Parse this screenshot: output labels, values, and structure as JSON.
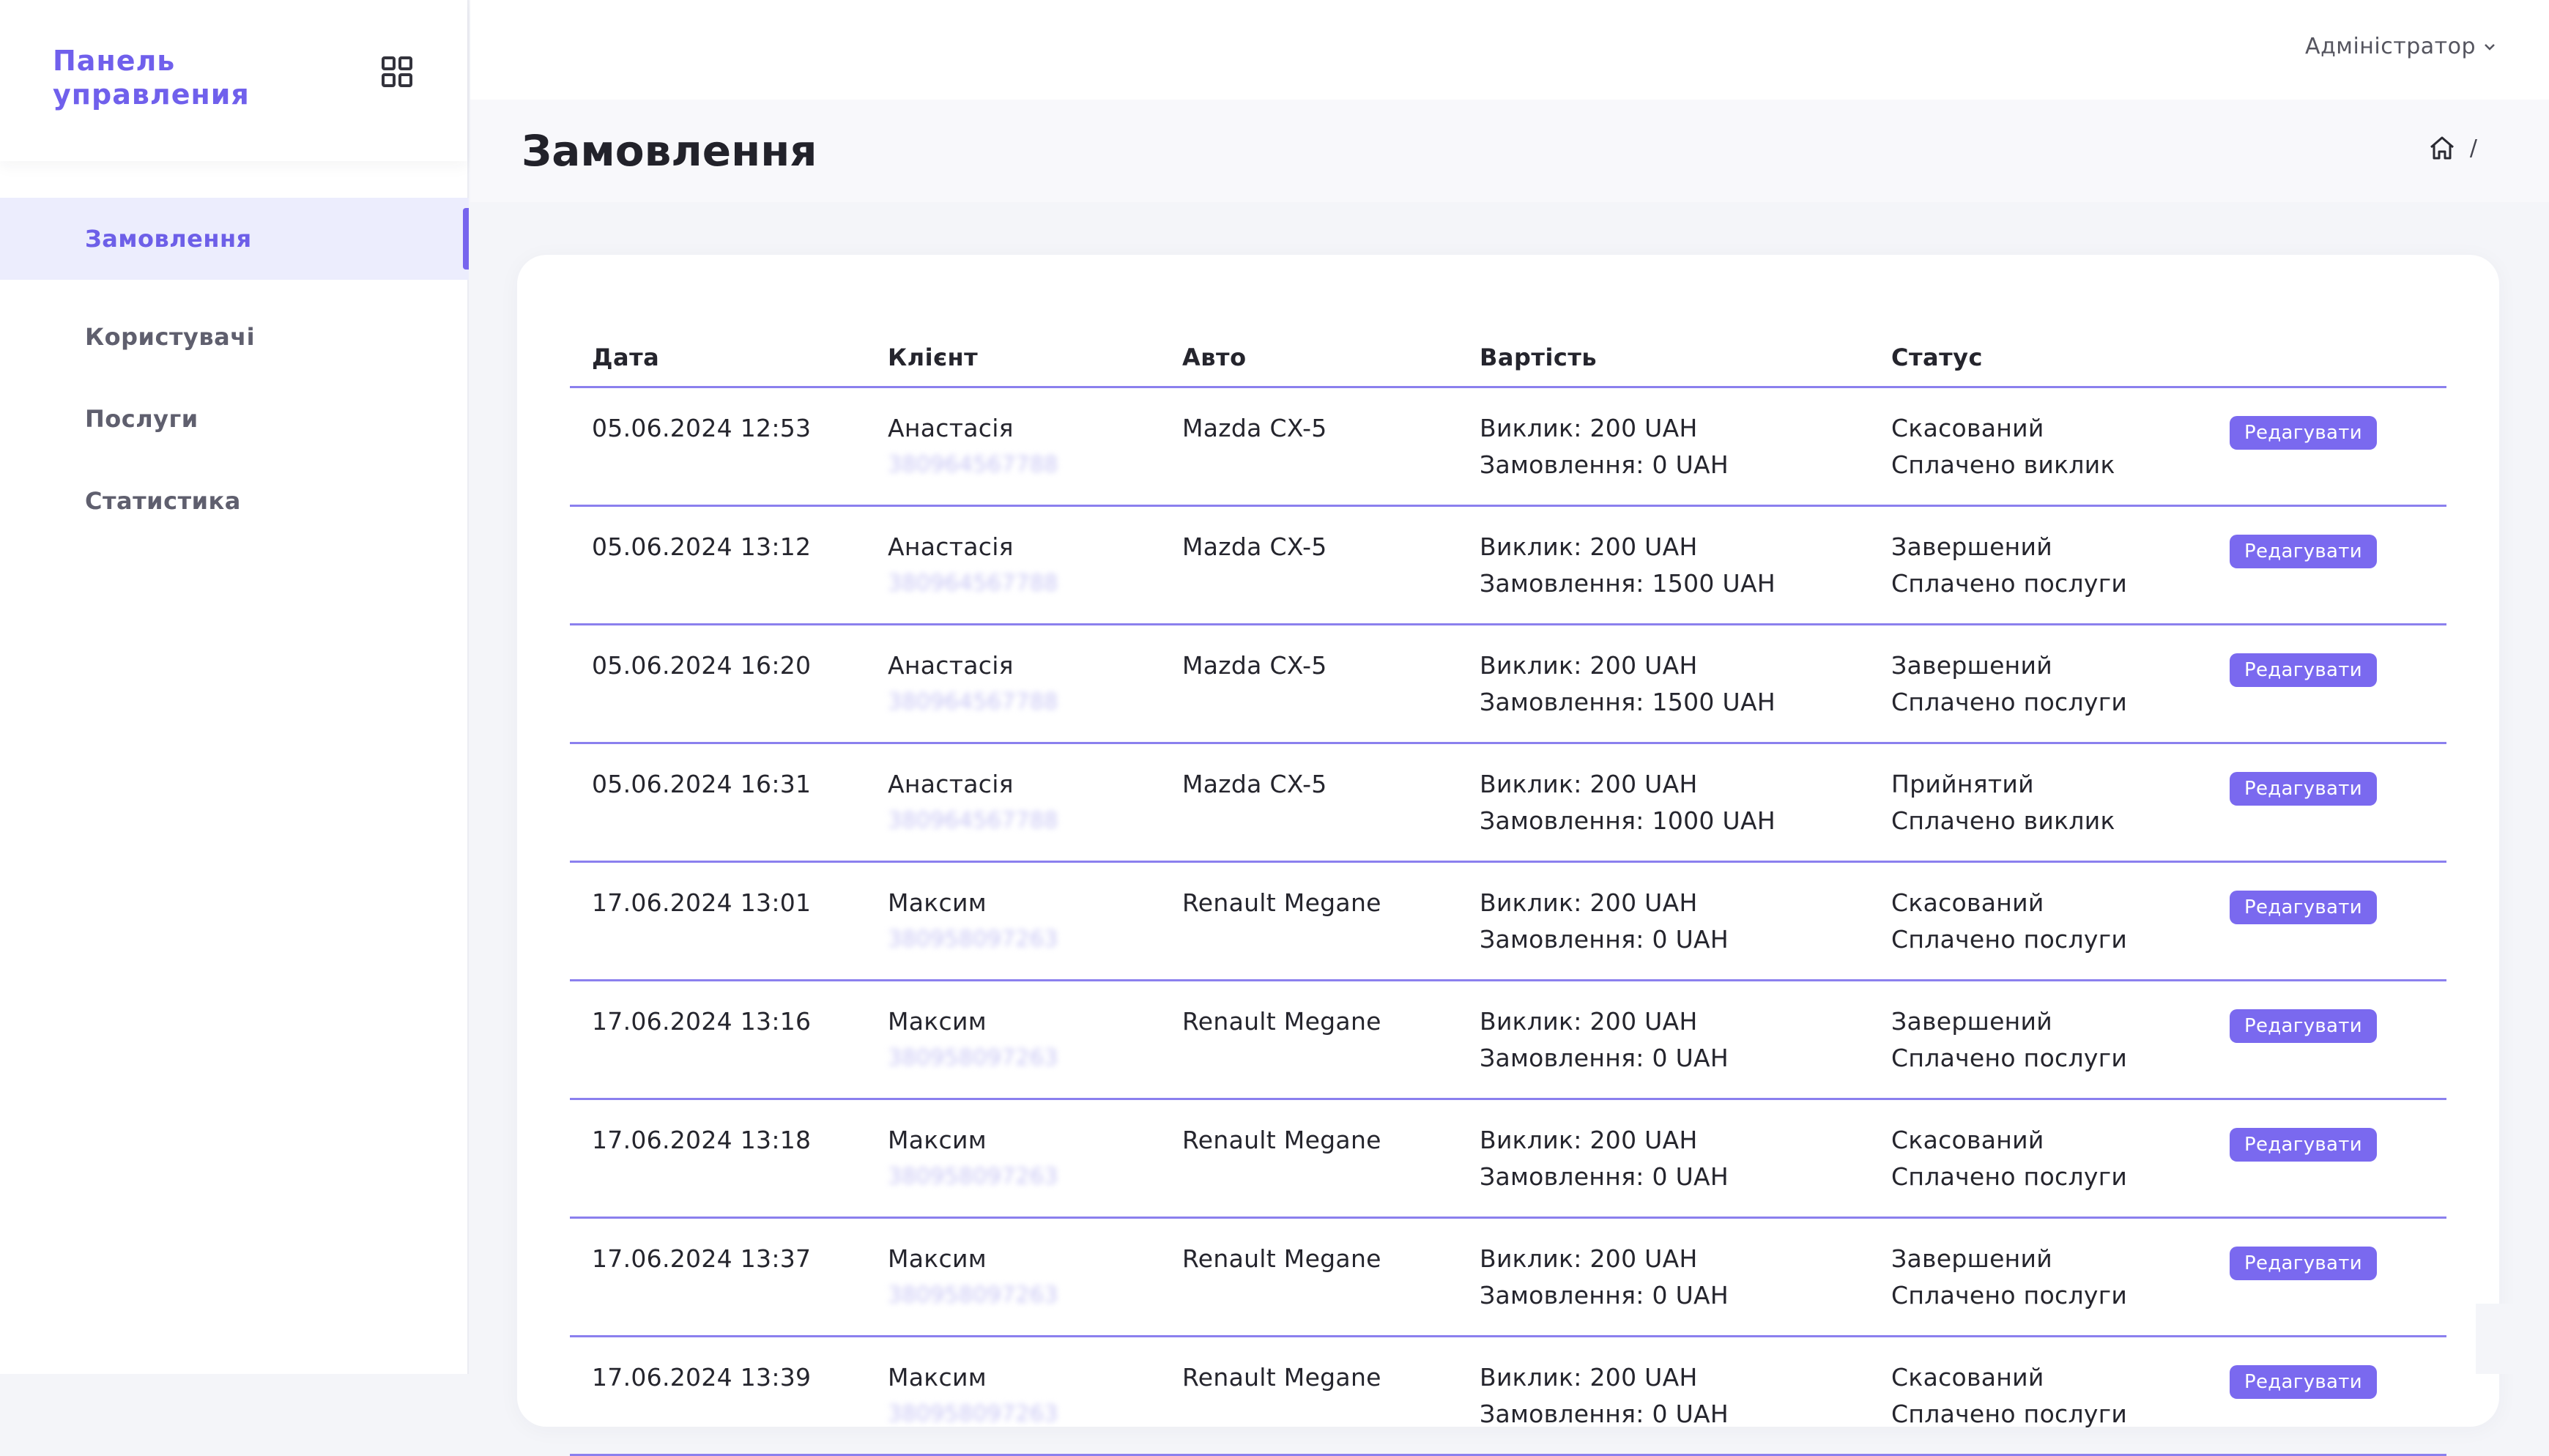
{
  "sidebar": {
    "brand": "Панель управления",
    "items": [
      {
        "label": "Замовлення",
        "active": true
      },
      {
        "label": "Користувачі"
      },
      {
        "label": "Послуги"
      },
      {
        "label": "Статистика"
      }
    ]
  },
  "topbar": {
    "user": "Адміністратор"
  },
  "header": {
    "title": "Замовлення",
    "breadcrumb_sep": "/"
  },
  "table": {
    "columns": [
      "Дата",
      "Клієнт",
      "Авто",
      "Вартість",
      "Статус"
    ],
    "edit_label": "Редагувати",
    "rows": [
      {
        "date": "05.06.2024 12:53",
        "client": "Анастасія",
        "phone": "380964567788",
        "car": "Mazda CX-5",
        "call": "Виклик: 200 UAH",
        "order": "Замовлення: 0 UAH",
        "status": "Скасований",
        "payment": "Сплачено виклик"
      },
      {
        "date": "05.06.2024 13:12",
        "client": "Анастасія",
        "phone": "380964567788",
        "car": "Mazda CX-5",
        "call": "Виклик: 200 UAH",
        "order": "Замовлення: 1500 UAH",
        "status": "Завершений",
        "payment": "Сплачено послуги"
      },
      {
        "date": "05.06.2024 16:20",
        "client": "Анастасія",
        "phone": "380964567788",
        "car": "Mazda CX-5",
        "call": "Виклик: 200 UAH",
        "order": "Замовлення: 1500 UAH",
        "status": "Завершений",
        "payment": "Сплачено послуги"
      },
      {
        "date": "05.06.2024 16:31",
        "client": "Анастасія",
        "phone": "380964567788",
        "car": "Mazda CX-5",
        "call": "Виклик: 200 UAH",
        "order": "Замовлення: 1000 UAH",
        "status": "Прийнятий",
        "payment": "Сплачено виклик"
      },
      {
        "date": "17.06.2024 13:01",
        "client": "Максим",
        "phone": "380958097263",
        "car": "Renault Megane",
        "call": "Виклик: 200 UAH",
        "order": "Замовлення: 0 UAH",
        "status": "Скасований",
        "payment": "Сплачено послуги"
      },
      {
        "date": "17.06.2024 13:16",
        "client": "Максим",
        "phone": "380958097263",
        "car": "Renault Megane",
        "call": "Виклик: 200 UAH",
        "order": "Замовлення: 0 UAH",
        "status": "Завершений",
        "payment": "Сплачено послуги"
      },
      {
        "date": "17.06.2024 13:18",
        "client": "Максим",
        "phone": "380958097263",
        "car": "Renault Megane",
        "call": "Виклик: 200 UAH",
        "order": "Замовлення: 0 UAH",
        "status": "Скасований",
        "payment": "Сплачено послуги"
      },
      {
        "date": "17.06.2024 13:37",
        "client": "Максим",
        "phone": "380958097263",
        "car": "Renault Megane",
        "call": "Виклик: 200 UAH",
        "order": "Замовлення: 0 UAH",
        "status": "Завершений",
        "payment": "Сплачено послуги"
      },
      {
        "date": "17.06.2024 13:39",
        "client": "Максим",
        "phone": "380958097263",
        "car": "Renault Megane",
        "call": "Виклик: 200 UAH",
        "order": "Замовлення: 0 UAH",
        "status": "Скасований",
        "payment": "Сплачено послуги"
      }
    ]
  },
  "colors": {
    "accent": "#7765ee",
    "active_bg": "#ecedfd",
    "divider": "#8b80ee"
  },
  "icons": {
    "dashboard": "grid-icon",
    "home": "home-icon",
    "dropdown": "chevron-down-icon"
  }
}
